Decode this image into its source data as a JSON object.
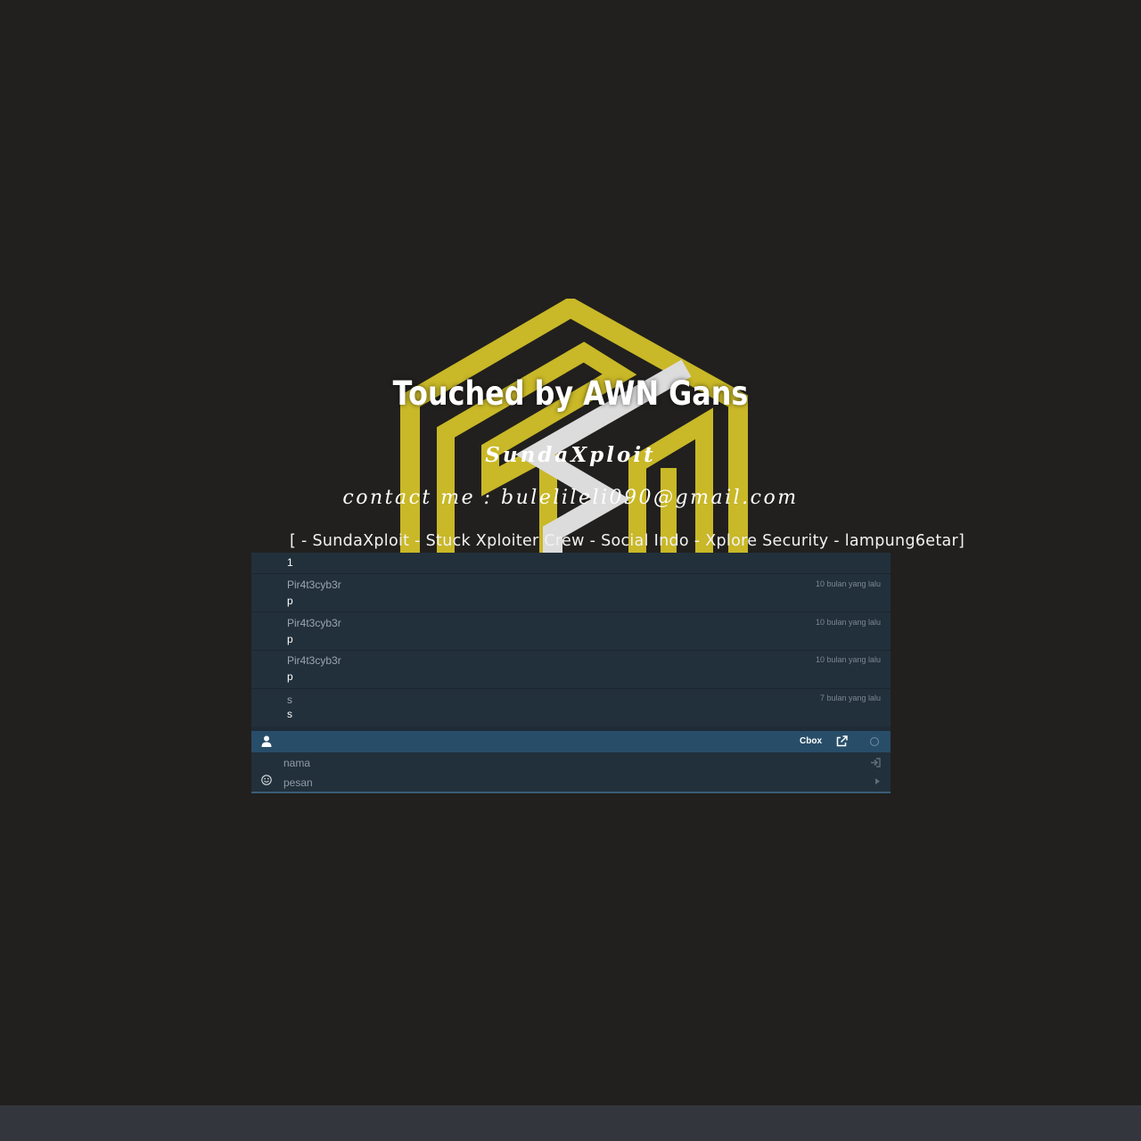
{
  "hero": {
    "title": "Touched by AWN Gans",
    "subtitle": "SundaXploit",
    "contact": "contact me : bulelileli090@gmail.com",
    "crews": "[ - SundaXploit - Stuck Xploiter Crew - Social Indo - Xplore Security - lampung6etar]",
    "logo_colors": {
      "gold": "#c9b827",
      "silver": "#dcdcdc"
    }
  },
  "chat": {
    "first_body": "1",
    "messages": [
      {
        "author": "Pir4t3cyb3r",
        "time": "10 bulan yang lalu",
        "body": "p"
      },
      {
        "author": "Pir4t3cyb3r",
        "time": "10 bulan yang lalu",
        "body": "p"
      },
      {
        "author": "Pir4t3cyb3r",
        "time": "10 bulan yang lalu",
        "body": "p"
      },
      {
        "author": "s",
        "time": "7 bulan yang lalu",
        "body": "s"
      }
    ],
    "toolbar": {
      "user_icon": "user-icon",
      "brand_label": "Cbox",
      "popout_icon": "external-link-icon",
      "status_icon": "status-circle-icon"
    },
    "form": {
      "name_placeholder": "nama",
      "name_value": "",
      "message_placeholder": "pesan",
      "message_value": "",
      "login_icon": "login-icon",
      "smiley_icon": "smiley-icon",
      "send_icon": "caret-right-icon"
    },
    "colors": {
      "toolbar": "#284d69",
      "panel": "#22303b"
    }
  },
  "page": {
    "background": "#21201e",
    "footer_color": "#33363d"
  }
}
